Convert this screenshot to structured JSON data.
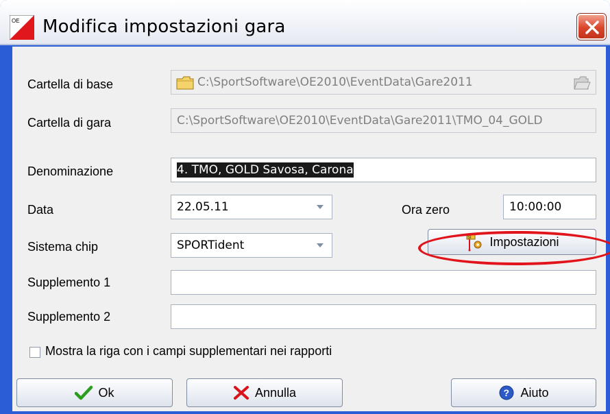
{
  "window": {
    "title": "Modifica impostazioni gara",
    "close_label": "Close"
  },
  "form": {
    "cartella_base": {
      "label": "Cartella di base",
      "value": "C:\\SportSoftware\\OE2010\\EventData\\Gare2011"
    },
    "cartella_gara": {
      "label": "Cartella di gara",
      "value": "C:\\SportSoftware\\OE2010\\EventData\\Gare2011\\TMO_04_GOLD"
    },
    "denominazione": {
      "label": "Denominazione",
      "value": "4. TMO, GOLD Savosa, Carona"
    },
    "data": {
      "label": "Data",
      "value": "22.05.11"
    },
    "ora_zero": {
      "label": "Ora zero",
      "value": "10:00:00"
    },
    "sistema_chip": {
      "label": "Sistema chip",
      "value": "SPORTident"
    },
    "impostazioni_button": "Impostazioni",
    "supplemento1": {
      "label": "Supplemento 1",
      "value": ""
    },
    "supplemento2": {
      "label": "Supplemento 2",
      "value": ""
    },
    "mostra_riga": {
      "label": "Mostra la riga con i campi supplementari nei rapporti",
      "checked": false
    }
  },
  "buttons": {
    "ok": "Ok",
    "annulla": "Annulla",
    "aiuto": "Aiuto"
  },
  "colors": {
    "frame": "#2b5ed6",
    "annotation": "#e0141a",
    "ok_check": "#2a9d1f",
    "cancel_x": "#d8141a",
    "help": "#2c59c6"
  },
  "icons": {
    "app": "oe-app-icon",
    "folder": "folder-icon",
    "browse": "browse-folder-icon",
    "settings": "chip-settings-icon",
    "ok": "checkmark-icon",
    "cancel": "x-icon",
    "help": "help-icon"
  }
}
